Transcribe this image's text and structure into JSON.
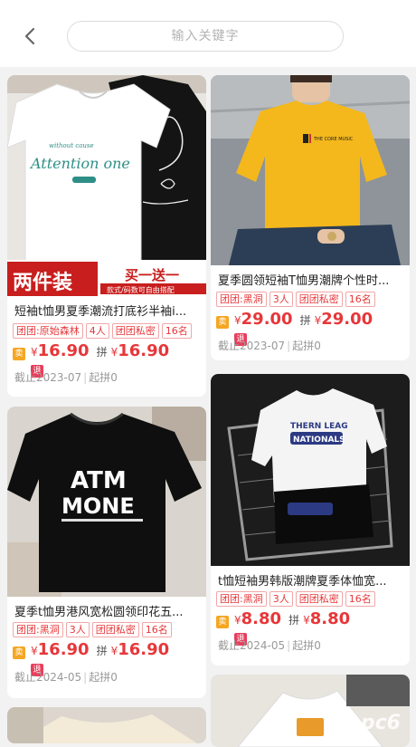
{
  "search": {
    "placeholder": "输入关键字"
  },
  "products": [
    {
      "title": "短袖t恤男夏季潮流打底衫半袖i...",
      "tags": [
        "团团:原始森林",
        "4人",
        "团团私密",
        "16名"
      ],
      "sell_badge": "卖",
      "back_badge": "退",
      "currency": "¥",
      "price": "16.90",
      "pin_label": "拼",
      "pin_price": "16.90",
      "deadline": "截止2023-07",
      "min_group": "起拼0",
      "banner_left": "两件装",
      "banner_right": "买一送一",
      "banner_sub": "款式/码数可自由搭配",
      "shirt_text": "Attention one",
      "shirt_sub": "without cause"
    },
    {
      "title": "夏季圆领短袖T恤男潮牌个性时...",
      "tags": [
        "团团:黑洞",
        "3人",
        "团团私密",
        "16名"
      ],
      "sell_badge": "卖",
      "back_badge": "退",
      "currency": "¥",
      "price": "29.00",
      "pin_label": "拼",
      "pin_price": "29.00",
      "deadline": "截止2023-07",
      "min_group": "起拼0",
      "shirt_text": "THE CORE MUSIC"
    },
    {
      "title": "夏季t恤男港风宽松圆领印花五...",
      "tags": [
        "团团:黑洞",
        "3人",
        "团团私密",
        "16名"
      ],
      "sell_badge": "卖",
      "back_badge": "退",
      "currency": "¥",
      "price": "16.90",
      "pin_label": "拼",
      "pin_price": "16.90",
      "deadline": "截止2024-05",
      "min_group": "起拼0",
      "shirt_text_1": "ATM",
      "shirt_text_2": "MONE"
    },
    {
      "title": "t恤短袖男韩版潮牌夏季体恤宽...",
      "tags": [
        "团团:黑洞",
        "3人",
        "团团私密",
        "16名"
      ],
      "sell_badge": "卖",
      "back_badge": "退",
      "currency": "¥",
      "price": "8.80",
      "pin_label": "拼",
      "pin_price": "8.80",
      "deadline": "截止2024-05",
      "min_group": "起拼0",
      "shirt_text_1": "THERN LEAG",
      "shirt_text_2": "NATIONALS"
    }
  ],
  "watermark": "pc6"
}
